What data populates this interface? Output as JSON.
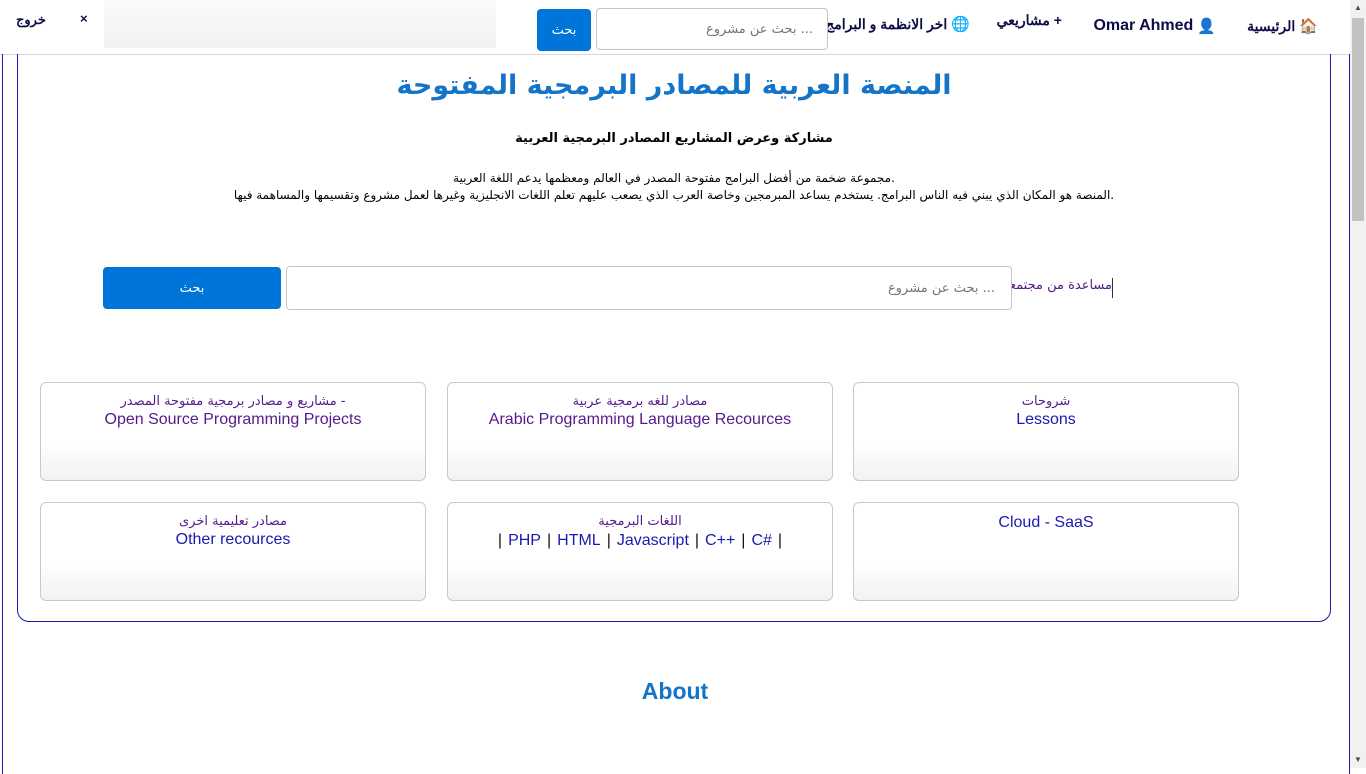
{
  "nav": {
    "home_label": "الرئيسية",
    "home_icon": "🏠",
    "user_name": "Omar Ahmed",
    "user_icon": "👤",
    "projects_label": "مشاريعي +",
    "latest_label": "اخر الانظمة و البرامج",
    "latest_icon": "🌐",
    "search_placeholder": "... بحث عن مشروع",
    "search_button": "بحث",
    "logout_label": "خروج",
    "close_label": "×"
  },
  "hero": {
    "title": "المنصة العربية للمصادر البرمجية المفتوحة",
    "subtitle": "مشاركة وعرض المشاريع المصادر البرمجية العربية",
    "desc_line1": ".مجموعة ضخمة من أفضل البرامج مفتوحة المصدر في العالم ومعظمها يدعم اللغة العربية",
    "desc_line2": ".المنصة هو المكان الذي يبني فيه الناس البرامج. يستخدم يساعد المبرمجين وخاصة العرب الذي يصعب عليهم تعلم اللغات الانجليزية وغيرها لعمل مشروع وتقسيمها والمساهمة فيها",
    "search_placeholder": "... بحث عن مشروع",
    "search_button": "بحث",
    "help_link": "مساعدة من مجتمعنا"
  },
  "cards": [
    {
      "ar": "- مشاريع و مصادر برمجية مفتوحة المصدر",
      "en": "Open Source Programming Projects"
    },
    {
      "ar": "مصادر للغه برمجية عربية",
      "en": "Arabic Programming Language Recources"
    },
    {
      "ar": "شروحات",
      "en": "Lessons"
    },
    {
      "ar": "مصادر تعليمية اخرى",
      "en": "Other recources"
    },
    {
      "ar": "اللغات البرمجية",
      "langs": [
        "PHP",
        "HTML",
        "Javascript",
        "C++",
        "C#"
      ]
    },
    {
      "en": "Cloud - SaaS"
    }
  ],
  "about": {
    "title": "About"
  },
  "colors": {
    "accent": "#0075d9",
    "heading": "#1474c8",
    "border": "#1a1ab0",
    "visited_link": "#551a8b"
  }
}
